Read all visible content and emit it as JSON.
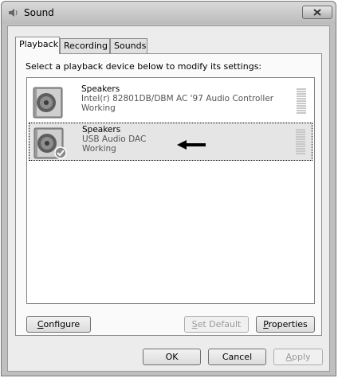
{
  "window": {
    "title": "Sound"
  },
  "tabs": [
    {
      "label": "Playback"
    },
    {
      "label": "Recording"
    },
    {
      "label": "Sounds"
    }
  ],
  "prompt": "Select a playback device below to modify its settings:",
  "devices": [
    {
      "name": "Speakers",
      "description": "Intel(r) 82801DB/DBM AC '97 Audio Controller",
      "status": "Working",
      "selected": false,
      "default": false,
      "icon": "speaker-icon"
    },
    {
      "name": "Speakers",
      "description": "USB Audio DAC",
      "status": "Working",
      "selected": true,
      "default": true,
      "icon": "speaker-icon"
    }
  ],
  "buttons": {
    "configure": {
      "first": "C",
      "rest": "onfigure"
    },
    "set_default": {
      "first": "S",
      "rest": "et Default"
    },
    "properties": {
      "first": "P",
      "rest": "roperties"
    },
    "ok": "OK",
    "cancel": "Cancel",
    "apply": {
      "first": "A",
      "rest": "pply"
    }
  }
}
